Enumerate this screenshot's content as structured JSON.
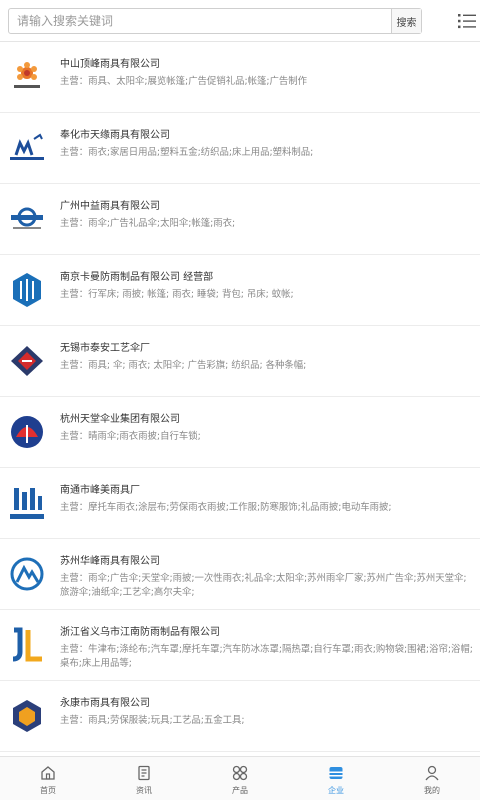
{
  "search": {
    "placeholder": "请输入搜索关键词",
    "button_label": "搜索"
  },
  "companies": [
    {
      "name": "中山顶峰雨具有限公司",
      "business": "主营：雨具、太阳伞;展览帐篷;广告促销礼品;帐篷;广告制作",
      "logo": "sunflower-logo-icon"
    },
    {
      "name": "奉化市天缘雨具有限公司",
      "business": "主营：雨衣;家居日用品;塑料五金;纺织品;床上用品;塑料制品;",
      "logo": "mk-robot-logo-icon"
    },
    {
      "name": "广州中益雨具有限公司",
      "business": "主营：雨伞;广告礼品伞;太阳伞;帐篷;雨衣;",
      "logo": "wuntan-logo-icon"
    },
    {
      "name": "南京卡曼防雨制品有限公司 经营部",
      "business": "主营：行军床; 雨披; 帐篷; 雨衣; 睡袋; 背包; 吊床; 蚊帐;",
      "logo": "blue-hexagon-logo-icon"
    },
    {
      "name": "无锡市泰安工艺伞厂",
      "business": "主营：雨具; 伞; 雨衣; 太阳伞; 广告彩旗; 纺织品; 各种条幅;",
      "logo": "red-diamond-logo-icon"
    },
    {
      "name": "杭州天堂伞业集团有限公司",
      "business": "主营：晴雨伞;雨衣雨披;自行车锁;",
      "logo": "umbrella-logo-icon"
    },
    {
      "name": "南通市峰美雨具厂",
      "business": "主营：摩托车雨衣;涂层布;劳保雨衣雨披;工作服;防寒服饰;礼品雨披;电动车雨披;",
      "logo": "meilan-logo-icon"
    },
    {
      "name": "苏州华峰雨具有限公司",
      "business": "主营：雨伞;广告伞;天堂伞;雨披;一次性雨衣;礼品伞;太阳伞;苏州雨伞厂家;苏州广告伞;苏州天堂伞;旅游伞;油纸伞;工艺伞;高尔夫伞;",
      "logo": "mountain-circle-logo-icon"
    },
    {
      "name": "浙江省义乌市江南防雨制品有限公司",
      "business": "主营：牛津布;涤纶布;汽车罩;摩托车罩;汽车防冰冻罩;隔热罩;自行车罩;雨衣;购物袋;围裙;浴帘;浴帽;桌布;床上用品等;",
      "logo": "jl-logo-icon"
    },
    {
      "name": "永康市雨具有限公司",
      "business": "主营：雨具;劳保服装;玩具;工艺品;五金工具;",
      "logo": "yk-logo-icon"
    }
  ],
  "tabs": [
    {
      "label": "首页",
      "icon": "home-icon"
    },
    {
      "label": "资讯",
      "icon": "news-icon"
    },
    {
      "label": "产品",
      "icon": "grid-icon"
    },
    {
      "label": "企业",
      "icon": "company-icon",
      "active": true
    },
    {
      "label": "我的",
      "icon": "user-icon"
    }
  ],
  "colors": {
    "accent": "#2f8fe0",
    "text": "#333333",
    "muted": "#888888",
    "border": "#ececec"
  }
}
